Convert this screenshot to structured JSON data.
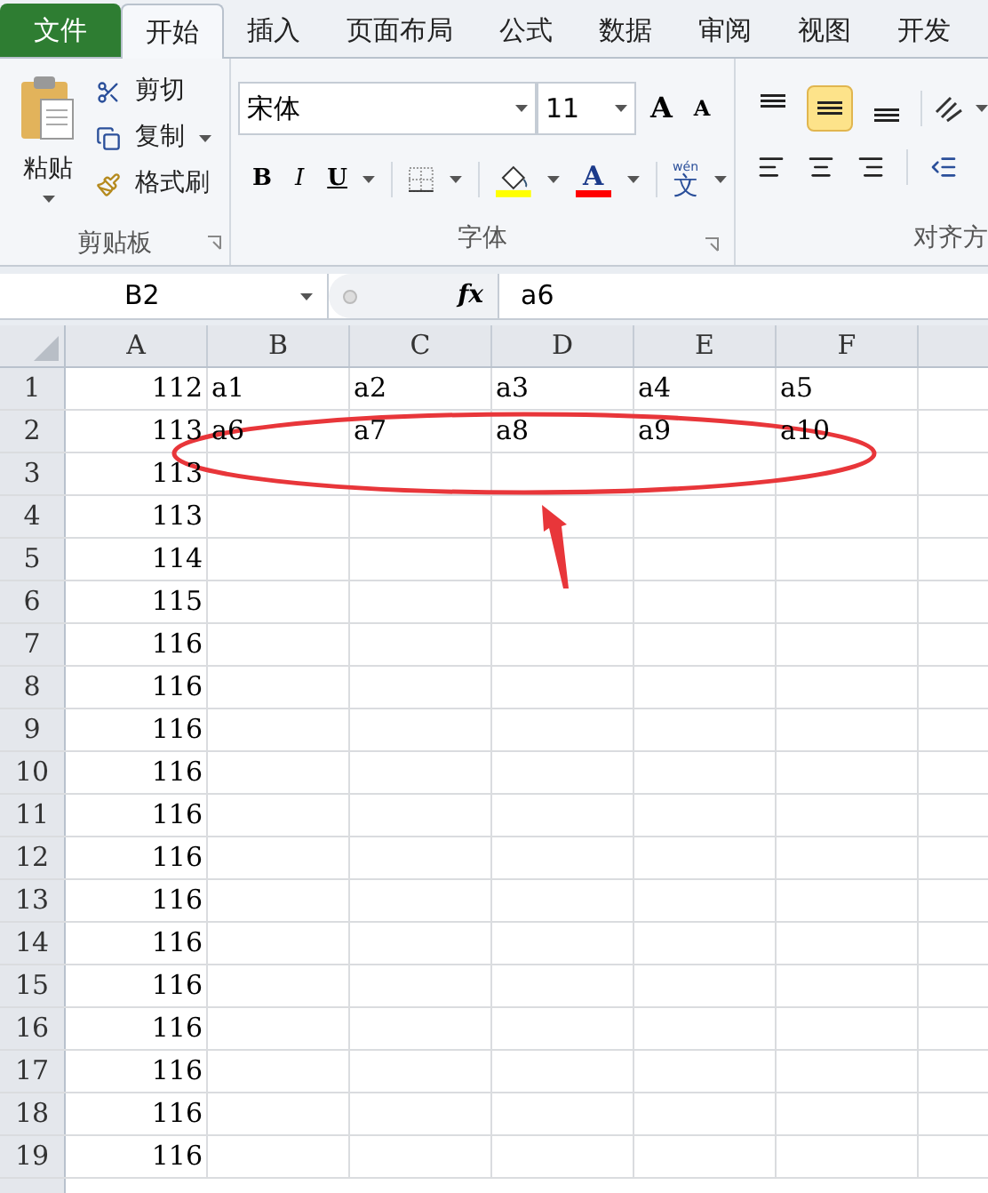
{
  "tabs": [
    {
      "label": "文件",
      "kind": "file",
      "selected": false
    },
    {
      "label": "开始",
      "kind": "tab",
      "selected": true
    },
    {
      "label": "插入",
      "kind": "tab",
      "selected": false
    },
    {
      "label": "页面布局",
      "kind": "tab",
      "selected": false
    },
    {
      "label": "公式",
      "kind": "tab",
      "selected": false
    },
    {
      "label": "数据",
      "kind": "tab",
      "selected": false
    },
    {
      "label": "审阅",
      "kind": "tab",
      "selected": false
    },
    {
      "label": "视图",
      "kind": "tab",
      "selected": false
    },
    {
      "label": "开发",
      "kind": "tab",
      "selected": false
    }
  ],
  "clipboard": {
    "paste": "粘贴",
    "cut": "剪切",
    "copy": "复制",
    "format_painter": "格式刷",
    "group_label": "剪贴板"
  },
  "font": {
    "name": "宋体",
    "size": "11",
    "grow": "A",
    "shrink": "A",
    "bold": "B",
    "italic": "I",
    "underline": "U",
    "font_color": "A",
    "phonetic_top": "wén",
    "phonetic": "文",
    "group_label": "字体"
  },
  "alignment": {
    "group_label": "对齐方",
    "buttons": [
      {
        "kind": "top",
        "selected": false
      },
      {
        "kind": "middle",
        "selected": true
      },
      {
        "kind": "bottom",
        "selected": false
      }
    ]
  },
  "formula_bar": {
    "name_box": "B2",
    "fx": "fx",
    "value": "a6"
  },
  "sheet": {
    "columns": [
      "A",
      "B",
      "C",
      "D",
      "E",
      "F"
    ],
    "rows": [
      {
        "number": "1",
        "values": [
          "112",
          "a1",
          "a2",
          "a3",
          "a4",
          "a5"
        ]
      },
      {
        "number": "2",
        "values": [
          "113",
          "a6",
          "a7",
          "a8",
          "a9",
          "a10"
        ]
      },
      {
        "number": "3",
        "values": [
          "113"
        ]
      },
      {
        "number": "4",
        "values": [
          "113"
        ]
      },
      {
        "number": "5",
        "values": [
          "114"
        ]
      },
      {
        "number": "6",
        "values": [
          "115"
        ]
      },
      {
        "number": "7",
        "values": [
          "116"
        ]
      },
      {
        "number": "8",
        "values": [
          "116"
        ]
      },
      {
        "number": "9",
        "values": [
          "116"
        ]
      },
      {
        "number": "10",
        "values": [
          "116"
        ]
      },
      {
        "number": "11",
        "values": [
          "116"
        ]
      },
      {
        "number": "12",
        "values": [
          "116"
        ]
      },
      {
        "number": "13",
        "values": [
          "116"
        ]
      },
      {
        "number": "14",
        "values": [
          "116"
        ]
      },
      {
        "number": "15",
        "values": [
          "116"
        ]
      },
      {
        "number": "16",
        "values": [
          "116"
        ]
      },
      {
        "number": "17",
        "values": [
          "116"
        ]
      },
      {
        "number": "18",
        "values": [
          "116"
        ]
      },
      {
        "number": "19",
        "values": [
          "116"
        ]
      }
    ]
  }
}
